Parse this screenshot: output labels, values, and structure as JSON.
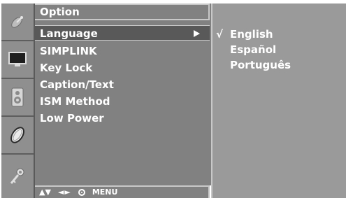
{
  "menu": {
    "title": "Option",
    "items": [
      {
        "label": "Language",
        "selected": true
      },
      {
        "label": "SIMPLINK",
        "selected": false
      },
      {
        "label": "Key Lock",
        "selected": false
      },
      {
        "label": "Caption/Text",
        "selected": false
      },
      {
        "label": "ISM Method",
        "selected": false
      },
      {
        "label": "Low Power",
        "selected": false
      }
    ]
  },
  "submenu": {
    "check_mark": "√",
    "items": [
      {
        "label": "English",
        "checked": true
      },
      {
        "label": "Español",
        "checked": false
      },
      {
        "label": "Português",
        "checked": false
      }
    ]
  },
  "footer": {
    "updown": "▲▼",
    "leftright": "◄►",
    "menu_label": "MENU"
  },
  "icons": [
    "satellite-dish-icon",
    "screen-icon",
    "speaker-icon",
    "clock-icon",
    "key-icon"
  ],
  "colors": {
    "menu_bg": "#818181",
    "selected_bg": "#595959",
    "submenu_bg": "#9a9a9a",
    "icon_strip_bg": "#8f8f8f",
    "text": "#ffffff"
  }
}
